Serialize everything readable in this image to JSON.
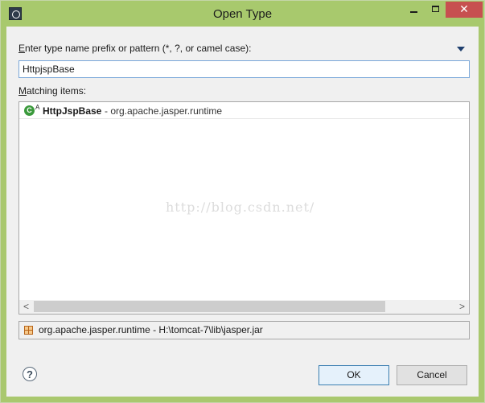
{
  "window": {
    "title": "Open Type",
    "minimize_glyph": "",
    "close_glyph": "✕"
  },
  "prompt": {
    "mnemonic": "E",
    "rest": "nter type name prefix or pattern (*, ?, or camel case):"
  },
  "search": {
    "value": "HttpjspBase"
  },
  "matching": {
    "mnemonic": "M",
    "rest": "atching items:"
  },
  "results": [
    {
      "icon": "class-icon",
      "icon_glyph": "C",
      "modifier": "A",
      "name": "HttpJspBase",
      "qualifier": "- org.apache.jasper.runtime"
    }
  ],
  "watermark": "http://blog.csdn.net/",
  "scrollbar": {
    "left_glyph": "<",
    "right_glyph": ">"
  },
  "status": {
    "icon": "jar-icon",
    "text": "org.apache.jasper.runtime - H:\\tomcat-7\\lib\\jasper.jar"
  },
  "buttons": {
    "help_glyph": "?",
    "ok": "OK",
    "cancel": "Cancel"
  },
  "colors": {
    "titlebar": "#a8c96d",
    "close": "#c75050",
    "ok_border": "#3c7fb1",
    "class_icon": "#3b9a3c"
  }
}
